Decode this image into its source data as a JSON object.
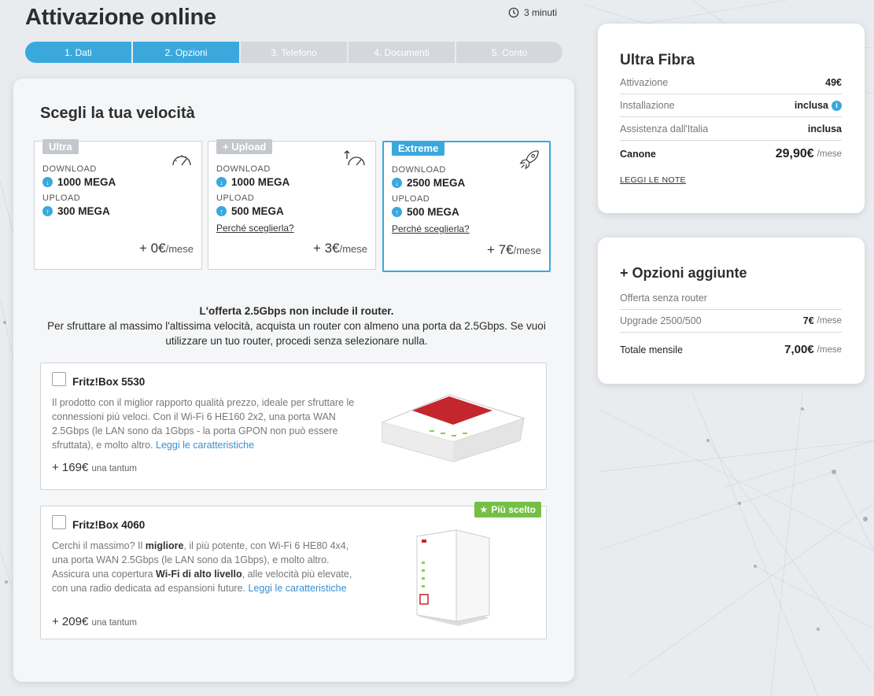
{
  "header": {
    "title": "Attivazione online",
    "eta": "3 minuti"
  },
  "steps": [
    "1. Dati",
    "2. Opzioni",
    "3. Telefono",
    "4. Documenti",
    "5. Conto"
  ],
  "speed": {
    "title": "Scegli la tua velocità",
    "download_label": "DOWNLOAD",
    "upload_label": "UPLOAD",
    "why_label": "Perché sceglierla?",
    "per_month": "/mese",
    "plans": [
      {
        "tag": "Ultra",
        "download": "1000 MEGA",
        "upload": "300 MEGA",
        "price": "+ 0€",
        "icon": "speedometer-icon"
      },
      {
        "tag": "+ Upload",
        "download": "1000 MEGA",
        "upload": "500 MEGA",
        "price": "+ 3€",
        "icon": "speedometer-up-icon"
      },
      {
        "tag": "Extreme",
        "download": "2500 MEGA",
        "upload": "500 MEGA",
        "price": "+ 7€",
        "icon": "rocket-icon"
      }
    ]
  },
  "notice": {
    "headline": "L'offerta 2.5Gbps non include il router.",
    "body": "Per sfruttare al massimo l'altissima velocità, acquista un router con almeno una porta da 2.5Gbps. Se vuoi utilizzare un tuo router, procedi senza selezionare nulla."
  },
  "routers": [
    {
      "name": "Fritz!Box 5530",
      "desc": "Il prodotto con il miglior rapporto qualità prezzo, ideale per sfruttare le connessioni più veloci. Con il Wi-Fi 6 HE160 2x2, una porta WAN 2.5Gbps (le LAN sono da 1Gbps - la porta GPON non può essere sfruttata), e molto altro.",
      "link": "Leggi le caratteristiche",
      "price": "+ 169€",
      "price_note": "una tantum"
    },
    {
      "name": "Fritz!Box 4060",
      "desc_1": "Cerchi il massimo? Il ",
      "desc_2": "migliore",
      "desc_3": ", il più potente, con Wi-Fi 6 HE80 4x4, una porta WAN 2.5Gbps (le LAN sono da 1Gbps), e molto altro. Assicura una copertura ",
      "desc_4": "Wi-Fi di alto livello",
      "desc_5": ", alle velocità più elevate, con una radio dedicata ad espansioni future.",
      "link": "Leggi le caratteristiche",
      "price": "+ 209€",
      "price_note": "una tantum",
      "badge": "Più scelto"
    }
  ],
  "summary": {
    "title": "Ultra Fibra",
    "rows": [
      {
        "k": "Attivazione",
        "v": "49€"
      },
      {
        "k": "Installazione",
        "v": "inclusa"
      },
      {
        "k": "Assistenza dall'Italia",
        "v": "inclusa"
      },
      {
        "k": "Canone",
        "v": "29,90€",
        "unit": "/mese"
      }
    ],
    "notes_link": "LEGGI LE NOTE"
  },
  "options": {
    "title": "+ Opzioni aggiunte",
    "rows": [
      {
        "k": "Offerta senza router",
        "v": ""
      },
      {
        "k": "Upgrade 2500/500",
        "v": "7€",
        "unit": "/mese"
      },
      {
        "k": "Totale mensile",
        "v": "7,00€",
        "unit": "/mese"
      }
    ]
  },
  "colors": {
    "accent": "#3aa8dd",
    "popular": "#74bf44"
  }
}
